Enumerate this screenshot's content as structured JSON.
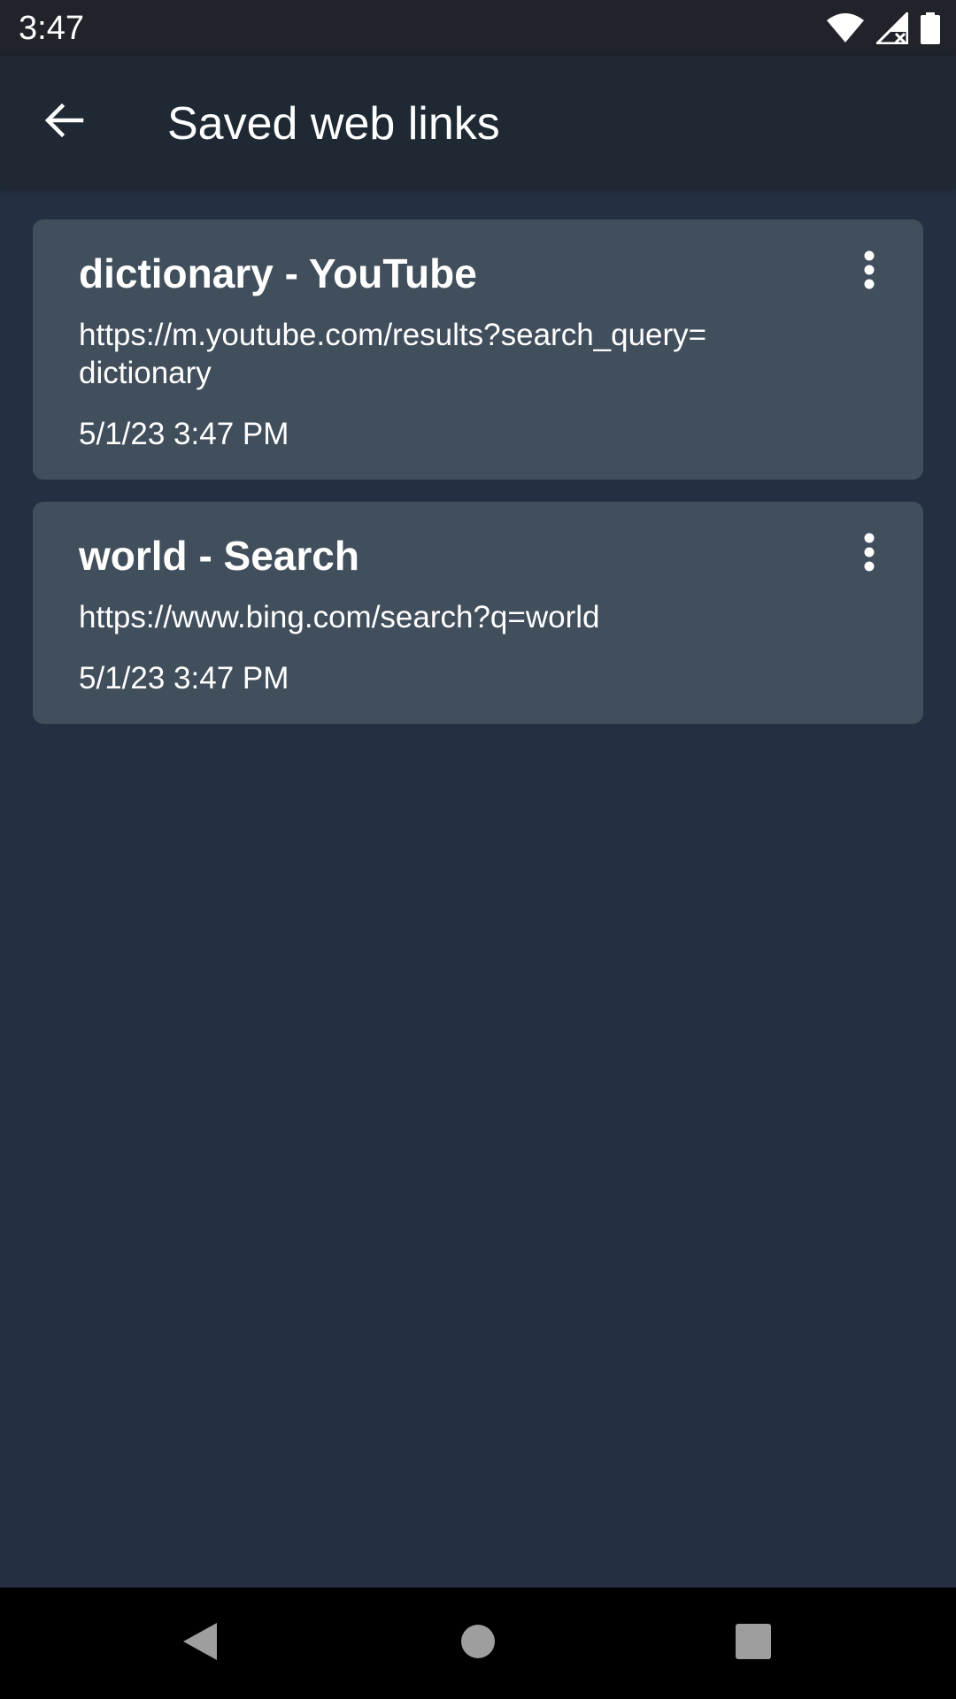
{
  "status_bar": {
    "time": "3:47",
    "icons": [
      "wifi-icon",
      "signal-icon",
      "battery-icon"
    ]
  },
  "app_bar": {
    "title": "Saved web links",
    "back_icon": "arrow-back-icon"
  },
  "links": [
    {
      "title": "dictionary - YouTube",
      "url": "https://m.youtube.com/results?search_query=​dictionary",
      "date": "5/1/23 3:47 PM",
      "menu_icon": "more-vert-icon"
    },
    {
      "title": "world - Search",
      "url": "https://www.bing.com/search?q=world",
      "date": "5/1/23 3:47 PM",
      "menu_icon": "more-vert-icon"
    }
  ],
  "nav_bar": {
    "buttons": [
      "back-triangle-icon",
      "home-circle-icon",
      "recents-square-icon"
    ]
  },
  "colors": {
    "background": "#243041",
    "app_bar": "#1f2934",
    "status_bar": "#202329",
    "card": "#414e5c",
    "nav_bar": "#000000",
    "text": "#ffffff"
  }
}
